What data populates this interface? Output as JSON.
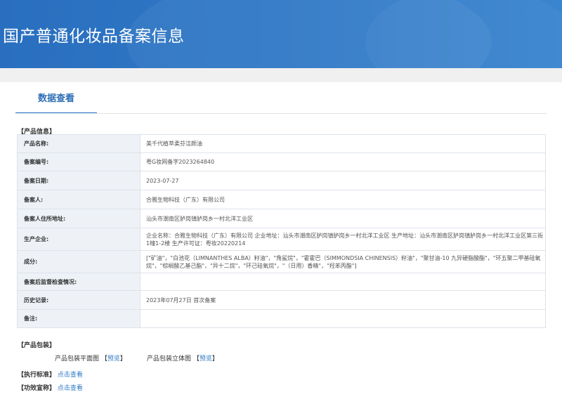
{
  "header": {
    "title": "国产普通化妆品备案信息"
  },
  "tab": {
    "label": "数据查看"
  },
  "product_section": {
    "title": "【产品信息】"
  },
  "rows": [
    {
      "label": "产品名称:",
      "value": "美千代植萃柔芬洁颜油"
    },
    {
      "label": "备案编号:",
      "value": "粤G妆网备字2023264840"
    },
    {
      "label": "备案日期:",
      "value": "2023-07-27"
    },
    {
      "label": "备案人:",
      "value": "合雅生物科技（广东）有限公司"
    },
    {
      "label": "备案人住所地址:",
      "value": "汕头市潮南区胪岗镇胪岗乡一村北洋工业区"
    },
    {
      "label": "生产企业:",
      "value": "企业名称：合雅生物科技（广东）有限公司 企业地址：汕头市潮南区胪岗镇胪岗乡一村北洋工业区 生产地址：汕头市潮南区胪岗镇胪岗乡一村北洋工业区第三街1幢1-2楼 生产许可证：粤妆20220214"
    },
    {
      "label": "成分:",
      "value": "[\"矿油\"，\"白池花（LIMNANTHES ALBA）籽油\"，\"角鲨烷\"，\"霍霍巴（SIMMONDSIA CHINENSIS）籽油\"，\"聚甘油-10 九异硬脂酸酯\"，\"环五聚二甲基硅氧烷\"，\"棕榈酸乙基己酯\"，\"异十二烷\"，\"环己硅氧烷\"，\"（日用）香精\"，\"羟苯丙酯\"]"
    },
    {
      "label": "备案后监督检查情况:",
      "value": ""
    },
    {
      "label": "历史记录:",
      "value": "2023年07月27日 首次备案"
    },
    {
      "label": "备注:",
      "value": ""
    }
  ],
  "package": {
    "title": "【产品包装】",
    "flat_label": "产品包装平面图",
    "solid_label": "产品包装立体图",
    "bracket_open": "【",
    "bracket_close": "】",
    "preview": "预览"
  },
  "standard": {
    "title": "【执行标准】",
    "link": "点击查看"
  },
  "efficacy": {
    "title": "【功效宣称】",
    "link": "点击查看"
  },
  "colors": {
    "banner": "#2f78c6",
    "link": "#2f78c6",
    "label_bg": "#eef2f7"
  }
}
